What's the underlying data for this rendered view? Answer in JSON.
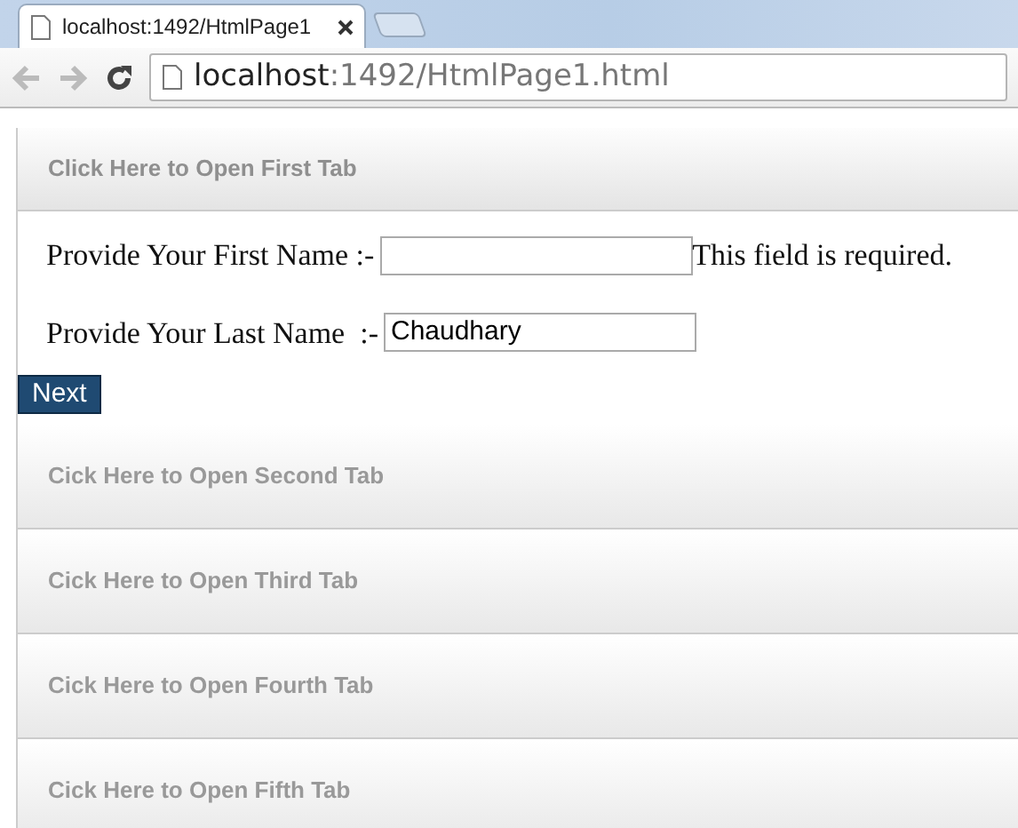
{
  "browser": {
    "tab_title": "localhost:1492/HtmlPage1",
    "url_host": "localhost",
    "url_rest": ":1492/HtmlPage1.html"
  },
  "sections": [
    {
      "heading": "Click Here to Open First Tab",
      "expanded": true,
      "fields": [
        {
          "label": "Provide Your First Name :-",
          "error": "This field is required."
        },
        {
          "label": "Provide Your Last Name  :-",
          "value": "Chaudhary"
        }
      ],
      "button": "Next"
    },
    {
      "heading": "Cick Here to Open Second Tab",
      "expanded": false
    },
    {
      "heading": "Cick Here to Open Third Tab",
      "expanded": false
    },
    {
      "heading": "Cick Here to Open Fourth Tab",
      "expanded": false
    },
    {
      "heading": "Cick Here to Open Fifth Tab",
      "expanded": false
    }
  ]
}
